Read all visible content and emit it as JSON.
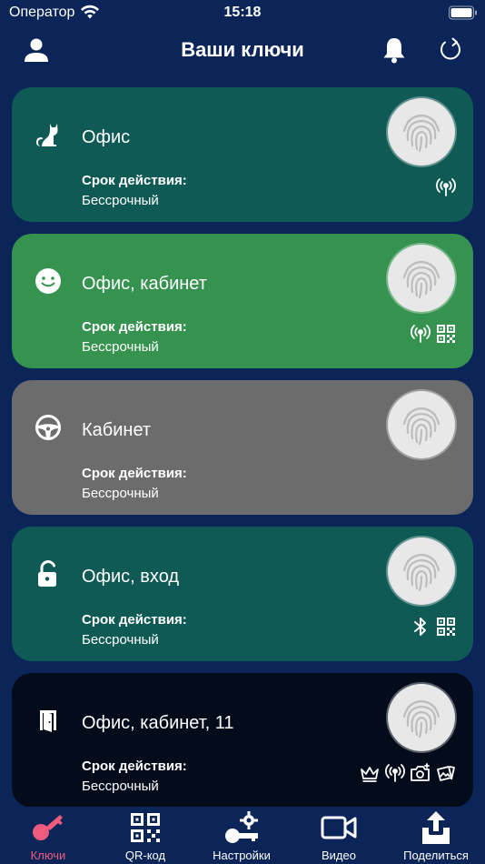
{
  "status_bar": {
    "carrier": "Оператор",
    "time": "15:18"
  },
  "header": {
    "title": "Ваши ключи",
    "left_icon": "user-icon",
    "bell_icon": "bell-icon",
    "refresh_icon": "refresh-icon"
  },
  "colors": {
    "background": "#0c2559",
    "card_teal": "#0f5a55",
    "card_green": "#35924f",
    "card_gray": "#6c6c6c",
    "card_black": "#040c1c",
    "tab_active": "#f05b7e"
  },
  "cards": [
    {
      "name": "Офис",
      "valid_label": "Срок действия:",
      "valid_value": "Бессрочный",
      "icon": "cat-icon",
      "color": "#0f5a55",
      "features": [
        "radio-icon"
      ]
    },
    {
      "name": "Офис, кабинет",
      "valid_label": "Срок действия:",
      "valid_value": "Бессрочный",
      "icon": "smile-icon",
      "color": "#35924f",
      "features": [
        "radio-icon",
        "qr-icon"
      ]
    },
    {
      "name": "Кабинет",
      "valid_label": "Срок действия:",
      "valid_value": "Бессрочный",
      "icon": "steering-wheel-icon",
      "color": "#6c6c6c",
      "features": []
    },
    {
      "name": "Офис, вход",
      "valid_label": "Срок действия:",
      "valid_value": "Бессрочный",
      "icon": "padlock-open-icon",
      "color": "#0f5a55",
      "features": [
        "bluetooth-icon",
        "qr-icon"
      ]
    },
    {
      "name": "Офис, кабинет, 11",
      "valid_label": "Срок действия:",
      "valid_value": "Бессрочный",
      "icon": "door-icon",
      "color": "#040c1c",
      "features": [
        "crown-icon",
        "radio-icon",
        "camera-icon",
        "photos-icon"
      ]
    }
  ],
  "tabs": [
    {
      "label": "Ключи",
      "icon": "key-icon",
      "active": true
    },
    {
      "label": "QR-код",
      "icon": "qr-icon",
      "active": false
    },
    {
      "label": "Настройки",
      "icon": "key-gear-icon",
      "active": false
    },
    {
      "label": "Видео",
      "icon": "video-camera-icon",
      "active": false
    },
    {
      "label": "Поделиться",
      "icon": "share-icon",
      "active": false
    }
  ]
}
